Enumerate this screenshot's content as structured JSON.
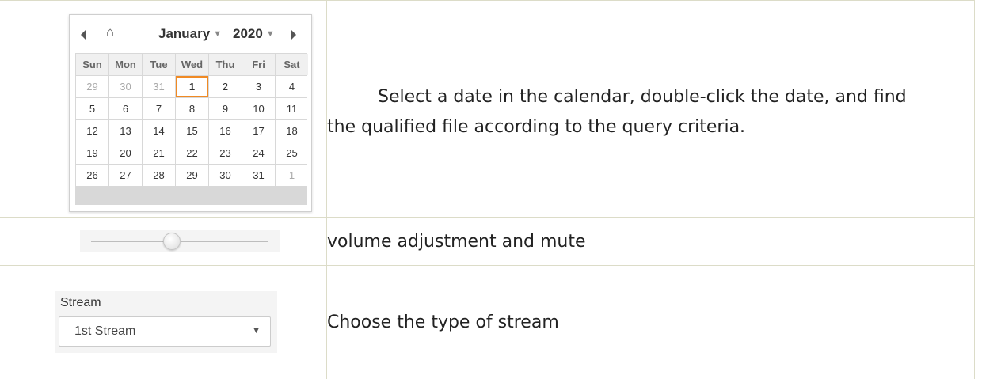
{
  "calendar": {
    "month": "January",
    "year": "2020",
    "weekdays": [
      "Sun",
      "Mon",
      "Tue",
      "Wed",
      "Thu",
      "Fri",
      "Sat"
    ],
    "weeks": [
      [
        "29",
        "30",
        "31",
        "1",
        "2",
        "3",
        "4"
      ],
      [
        "5",
        "6",
        "7",
        "8",
        "9",
        "10",
        "11"
      ],
      [
        "12",
        "13",
        "14",
        "15",
        "16",
        "17",
        "18"
      ],
      [
        "19",
        "20",
        "21",
        "22",
        "23",
        "24",
        "25"
      ],
      [
        "26",
        "27",
        "28",
        "29",
        "30",
        "31",
        "1"
      ]
    ],
    "selected_day": "1",
    "highlight_color": "#f08a24"
  },
  "volume": {
    "level": 0.45
  },
  "stream": {
    "label": "Stream",
    "selected": "1st Stream"
  },
  "descriptions": {
    "calendar_line1": "Select a date in the calendar, double-click the date, and find",
    "calendar_line2": "the qualified file according to the query criteria.",
    "volume": "volume adjustment and mute",
    "stream": "Choose the type of stream"
  }
}
